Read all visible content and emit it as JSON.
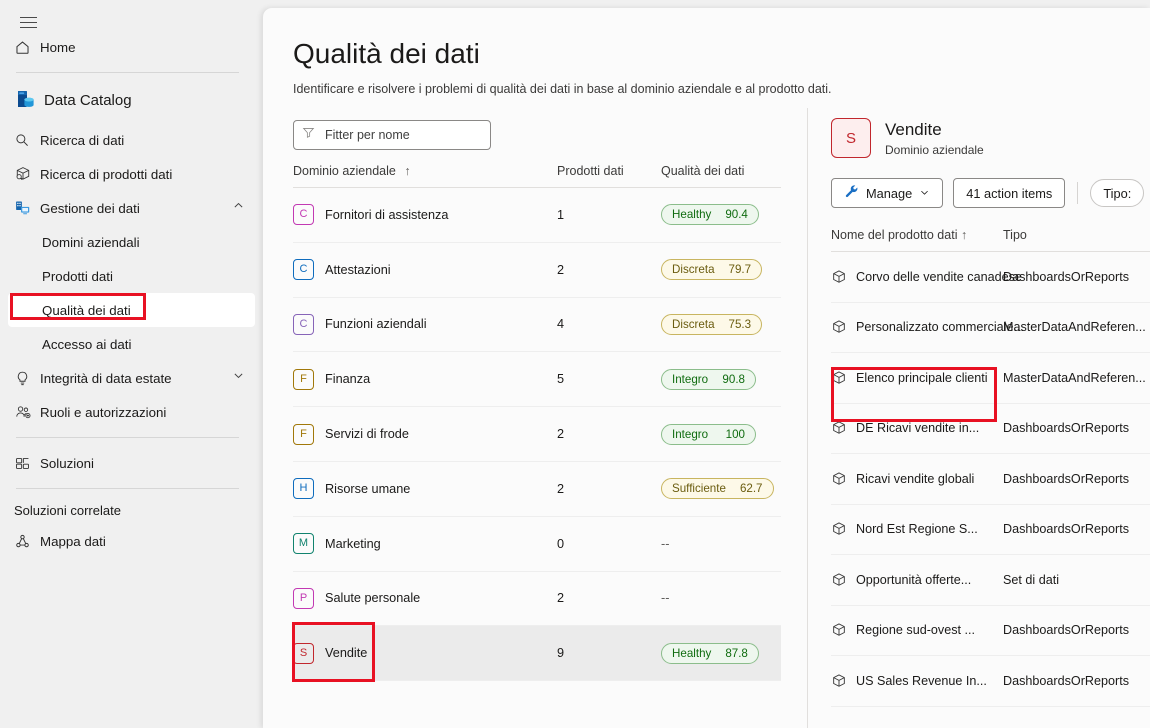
{
  "sidebar": {
    "hamburger_label": "menu",
    "home": {
      "label": "Home",
      "icon": "home-icon"
    },
    "brand": {
      "label": "Data Catalog",
      "icon": "data-catalog-icon"
    },
    "items": [
      {
        "label": "Ricerca di dati",
        "icon": "search-icon"
      },
      {
        "label": "Ricerca di prodotti dati",
        "icon": "package-search-icon"
      },
      {
        "label": "Gestione dei dati",
        "icon": "data-management-icon",
        "chevron": "chevron-up-icon"
      }
    ],
    "sub_items": [
      {
        "label": "Domini aziendali"
      },
      {
        "label": "Prodotti dati"
      },
      {
        "label": "Qualità dei dati",
        "selected": true
      },
      {
        "label": "Accesso ai dati"
      }
    ],
    "items2": [
      {
        "label": "Integrità di data estate",
        "icon": "lightbulb-icon",
        "chevron": "chevron-down-icon"
      },
      {
        "label": "Ruoli e autorizzazioni",
        "icon": "roles-icon"
      }
    ],
    "items3": [
      {
        "label": "Soluzioni",
        "icon": "solutions-icon"
      }
    ],
    "related_header": "Soluzioni correlate",
    "items4": [
      {
        "label": "Mappa dati",
        "icon": "data-map-icon"
      }
    ]
  },
  "main": {
    "title": "Qualità dei dati",
    "subtitle": "Identificare e risolvere i problemi di qualità dei dati in base al dominio aziendale e al prodotto dati.",
    "filter": {
      "placeholder": "Fitter per nome",
      "value": "",
      "icon": "filter-icon"
    },
    "table": {
      "columns": [
        "Dominio aziendale",
        "Prodotti dati",
        "Qualità dei dati"
      ],
      "sort_icon": "sort-ascending-icon",
      "rows": [
        {
          "initial": "C",
          "color": "#c239b3",
          "name": "Fornitori di assistenza",
          "products": "1",
          "quality_label": "Healthy",
          "quality_value": "90.4",
          "quality_tone": "green"
        },
        {
          "initial": "C",
          "color": "#0f6cbd",
          "name": "Attestazioni",
          "products": "2",
          "quality_label": "Discreta",
          "quality_value": "79.7",
          "quality_tone": "yellow"
        },
        {
          "initial": "C",
          "color": "#8764b8",
          "name": "Funzioni aziendali",
          "products": "4",
          "quality_label": "Discreta",
          "quality_value": "75.3",
          "quality_tone": "yellow"
        },
        {
          "initial": "F",
          "color": "#a1780a",
          "name": "Finanza",
          "products": "5",
          "quality_label": "Integro",
          "quality_value": "90.8",
          "quality_tone": "green"
        },
        {
          "initial": "F",
          "color": "#a1780a",
          "name": "Servizi di frode",
          "products": "2",
          "quality_label": "Integro",
          "quality_value": "100",
          "quality_tone": "green"
        },
        {
          "initial": "H",
          "color": "#0f6cbd",
          "name": "Risorse umane",
          "products": "2",
          "quality_label": "Sufficiente",
          "quality_value": "62.7",
          "quality_tone": "yellow"
        },
        {
          "initial": "M",
          "color": "#11836e",
          "name": "Marketing",
          "products": "0",
          "quality_label": "",
          "quality_value": "",
          "quality_tone": "none"
        },
        {
          "initial": "P",
          "color": "#c239b3",
          "name": "Salute personale",
          "products": "2",
          "quality_label": "",
          "quality_value": "",
          "quality_tone": "none"
        },
        {
          "initial": "S",
          "color": "#c1272d",
          "name": "Vendite",
          "products": "9",
          "quality_label": "Healthy",
          "quality_value": "87.8",
          "quality_tone": "green",
          "selected": true
        }
      ],
      "empty_value": "--"
    }
  },
  "detail": {
    "avatar_initial": "S",
    "title": "Vendite",
    "subtitle": "Dominio aziendale",
    "manage_button": "Manage",
    "manage_icon": "wrench-icon",
    "manage_chevron": "chevron-down-icon",
    "action_items_button": "41 action items",
    "type_filter_chip": "Tipo:",
    "table": {
      "columns": [
        "Nome del prodotto dati",
        "Tipo"
      ],
      "sort_icon": "sort-ascending-icon",
      "rows": [
        {
          "icon": "cube-icon",
          "name": "Corvo delle vendite canadese",
          "type": "DashboardsOrReports"
        },
        {
          "icon": "cube-icon",
          "name": "Personalizzato commerciale...",
          "type": "MasterDataAndReferen..."
        },
        {
          "icon": "cube-icon",
          "name": "Elenco principale clienti",
          "type": "MasterDataAndReferen...",
          "highlighted": true
        },
        {
          "icon": "cube-icon",
          "name": "DE Ricavi vendite in...",
          "type": "DashboardsOrReports"
        },
        {
          "icon": "cube-icon",
          "name": "Ricavi vendite globali",
          "type": "DashboardsOrReports"
        },
        {
          "icon": "cube-icon",
          "name": "Nord Est Regione S...",
          "type": "DashboardsOrReports"
        },
        {
          "icon": "cube-icon",
          "name": "Opportunità offerte...",
          "type": "Set di dati"
        },
        {
          "icon": "cube-icon",
          "name": "Regione sud-ovest ...",
          "type": "DashboardsOrReports"
        },
        {
          "icon": "cube-icon",
          "name": "US Sales Revenue In...",
          "type": "DashboardsOrReports"
        }
      ]
    }
  },
  "annotations": {
    "color": "#e81123",
    "boxes": [
      "sidebar-qualita-dei-dati",
      "table-row-vendite",
      "detail-row-elenco-principale-clienti"
    ]
  }
}
